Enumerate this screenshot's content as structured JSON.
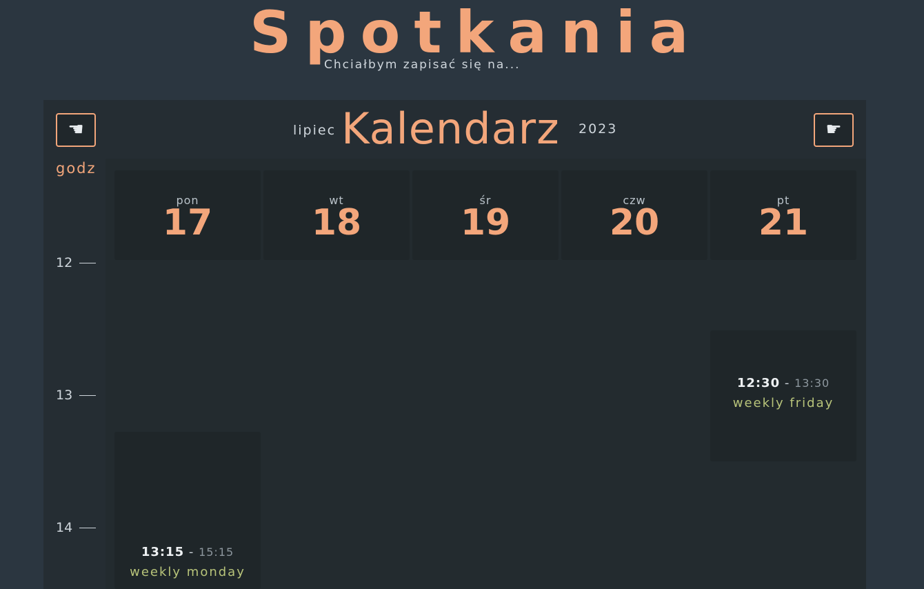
{
  "header": {
    "title": "Spotkania",
    "subtitle": "Chciałbym zapisać się na..."
  },
  "calendar": {
    "month": "lipiec",
    "title": "Kalendarz",
    "year": "2023",
    "prev_icon": "☚",
    "next_icon": "☛",
    "hours_label": "godz",
    "hours": [
      "12",
      "13",
      "14"
    ],
    "days": [
      {
        "name": "pon",
        "num": "17"
      },
      {
        "name": "wt",
        "num": "18"
      },
      {
        "name": "śr",
        "num": "19"
      },
      {
        "name": "czw",
        "num": "20"
      },
      {
        "name": "pt",
        "num": "21"
      }
    ],
    "events": [
      {
        "day": "pt",
        "start": "12:30",
        "sep": " - ",
        "end": "13:30",
        "title": "weekly friday"
      },
      {
        "day": "pon",
        "start": "13:15",
        "sep": " - ",
        "end": "15:15",
        "title": "weekly monday"
      }
    ]
  },
  "colors": {
    "accent": "#f3a67b",
    "background": "#2b3640",
    "event_title": "#b8c47a"
  }
}
